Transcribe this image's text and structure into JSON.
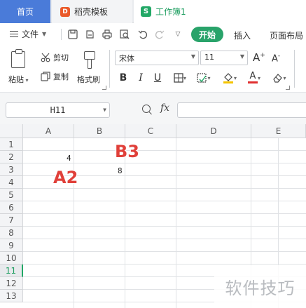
{
  "tabs": {
    "home": "首页",
    "template": "稻壳模板",
    "template_icon_letter": "D",
    "doc": "工作簿1",
    "doc_icon_letter": "S"
  },
  "menubar": {
    "file": "文件",
    "start": "开始",
    "insert": "插入",
    "page_layout": "页面布局"
  },
  "ribbon": {
    "paste": "粘贴",
    "cut": "剪切",
    "copy": "复制",
    "format_painter": "格式刷",
    "font_name": "宋体",
    "font_size": "11",
    "bold": "B",
    "italic": "I",
    "underline": "U",
    "grow": "A",
    "font_color_letter": "A"
  },
  "formula_bar": {
    "name_box": "H11",
    "fx": "fx",
    "formula": ""
  },
  "grid": {
    "columns": [
      "A",
      "B",
      "C",
      "D",
      "E"
    ],
    "rows": [
      "1",
      "2",
      "3",
      "4",
      "5",
      "6",
      "7",
      "8",
      "9",
      "10",
      "11",
      "12",
      "13"
    ],
    "active_row": "11",
    "cells": {
      "A2": "4",
      "B3": "8"
    }
  },
  "annotations": {
    "a2": "A2",
    "b3": "B3"
  },
  "watermark": "软件技巧",
  "colors": {
    "accent_green": "#22a866",
    "home_tab": "#4a7bd9",
    "annotation_red": "#e0403a"
  }
}
